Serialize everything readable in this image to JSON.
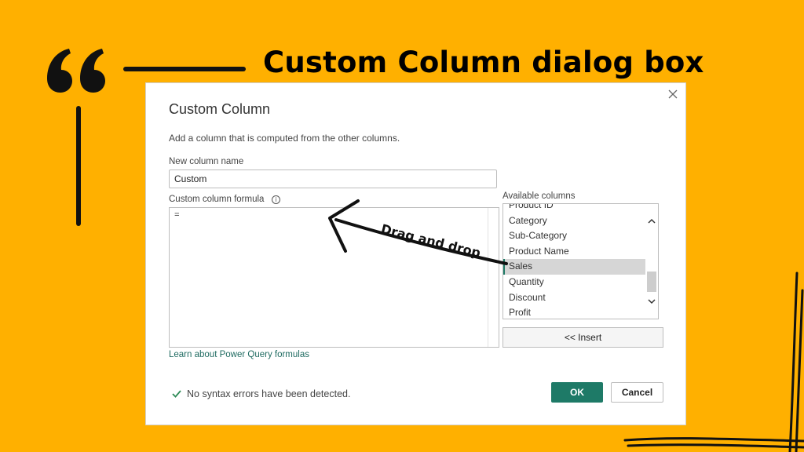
{
  "banner": {
    "title": "Custom Column dialog box"
  },
  "dialog": {
    "title": "Custom Column",
    "description": "Add a column that is computed from the other columns.",
    "new_column_label": "New column name",
    "new_column_value": "Custom",
    "formula_label": "Custom column formula",
    "formula_info_icon": "info-icon",
    "formula_value": "=",
    "learn_link": "Learn about Power Query formulas",
    "available_label": "Available columns",
    "available_columns": [
      "Product ID",
      "Category",
      "Sub-Category",
      "Product Name",
      "Sales",
      "Quantity",
      "Discount",
      "Profit"
    ],
    "selected_column": "Sales",
    "insert_label": "<< Insert",
    "status_text": "No syntax errors have been detected.",
    "ok_label": "OK",
    "cancel_label": "Cancel"
  },
  "annotation": {
    "text": "Drag and drop"
  },
  "colors": {
    "background": "#FFB000",
    "accent": "#1E7A67",
    "link": "#1F6B61"
  }
}
